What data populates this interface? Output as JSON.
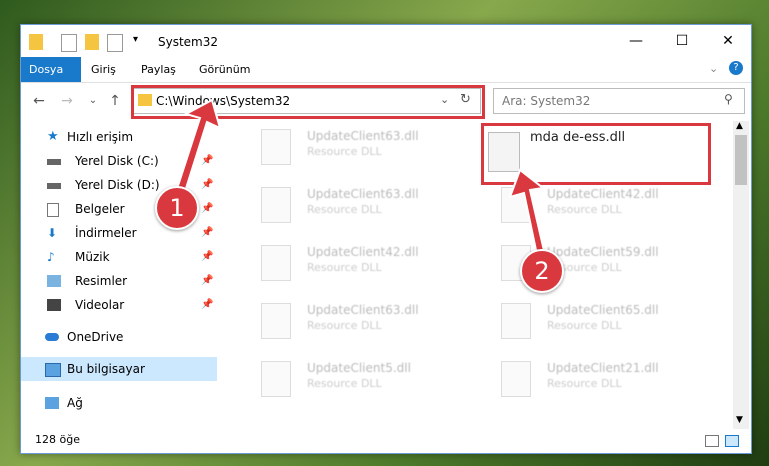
{
  "window": {
    "title": "System32"
  },
  "ribbon": {
    "tabs": [
      "Dosya",
      "Giriş",
      "Paylaş",
      "Görünüm"
    ]
  },
  "nav": {
    "address": "C:\\Windows\\System32",
    "search_placeholder": "Ara: System32"
  },
  "sidebar": {
    "items": [
      {
        "label": "Hızlı erişim",
        "icon": "star-icon"
      },
      {
        "label": "Yerel Disk (C:)",
        "icon": "drive-icon"
      },
      {
        "label": "Yerel Disk (D:)",
        "icon": "drive-icon"
      },
      {
        "label": "Belgeler",
        "icon": "documents-icon"
      },
      {
        "label": "İndirmeler",
        "icon": "download-icon"
      },
      {
        "label": "Müzik",
        "icon": "music-icon"
      },
      {
        "label": "Resimler",
        "icon": "pictures-icon"
      },
      {
        "label": "Videolar",
        "icon": "videos-icon"
      },
      {
        "label": "OneDrive",
        "icon": "cloud-icon"
      },
      {
        "label": "Bu bilgisayar",
        "icon": "computer-icon"
      },
      {
        "label": "Ağ",
        "icon": "network-icon"
      }
    ]
  },
  "files": [
    {
      "name": "UpdateClient63.dll",
      "type": "Resource DLL"
    },
    {
      "name": "UpdateClient63.dll",
      "type": "Resource DLL"
    },
    {
      "name": "UpdateClient42.dll",
      "type": "Resource DLL"
    },
    {
      "name": "UpdateClient42.dll",
      "type": "Resource DLL"
    },
    {
      "name": "UpdateClient59.dll",
      "type": "Resource DLL"
    },
    {
      "name": "UpdateClient63.dll",
      "type": "Resource DLL"
    },
    {
      "name": "UpdateClient65.dll",
      "type": "Resource DLL"
    },
    {
      "name": "UpdateClient5.dll",
      "type": "Resource DLL"
    },
    {
      "name": "UpdateClient21.dll",
      "type": "Resource DLL"
    }
  ],
  "target_file": {
    "name": "mda de-ess.dll"
  },
  "status": {
    "count": "128 öğe"
  },
  "annotations": {
    "step1": "1",
    "step2": "2"
  }
}
